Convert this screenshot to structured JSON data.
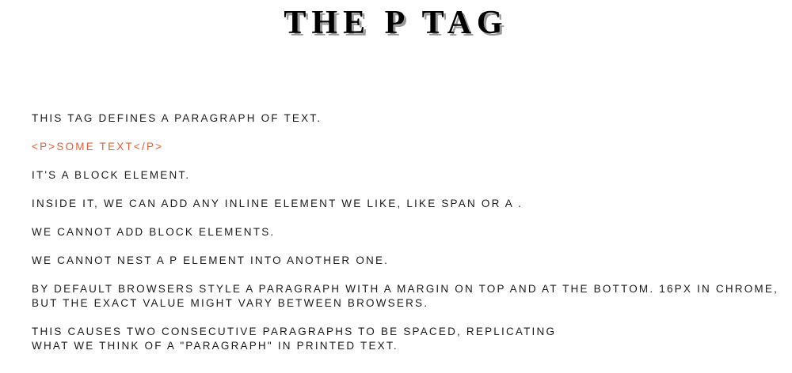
{
  "page": {
    "title": "THE P TAG"
  },
  "paragraphs": {
    "p1": "THIS TAG DEFINES A PARAGRAPH OF TEXT.",
    "code_example": "<P>SOME TEXT</P>",
    "p2": "IT'S A BLOCK ELEMENT.",
    "p3": "INSIDE IT, WE CAN ADD ANY INLINE ELEMENT WE LIKE, LIKE SPAN OR A .",
    "p4": "WE CANNOT ADD BLOCK ELEMENTS.",
    "p5": "WE CANNOT NEST A P ELEMENT INTO ANOTHER ONE.",
    "p6_line1": "BY DEFAULT BROWSERS STYLE A PARAGRAPH WITH A MARGIN ON TOP AND AT THE BOTTOM. 16PX IN CHROME,",
    "p6_line2": "BUT THE EXACT VALUE MIGHT VARY BETWEEN BROWSERS.",
    "p7_line1": "THIS CAUSES TWO CONSECUTIVE PARAGRAPHS TO BE SPACED, REPLICATING",
    "p7_line2": "WHAT WE THINK OF A \"PARAGRAPH\" IN PRINTED TEXT."
  },
  "colors": {
    "code_accent": "#e0603a",
    "text": "#1a1a1a",
    "title_shadow": "#9a9a9a"
  }
}
